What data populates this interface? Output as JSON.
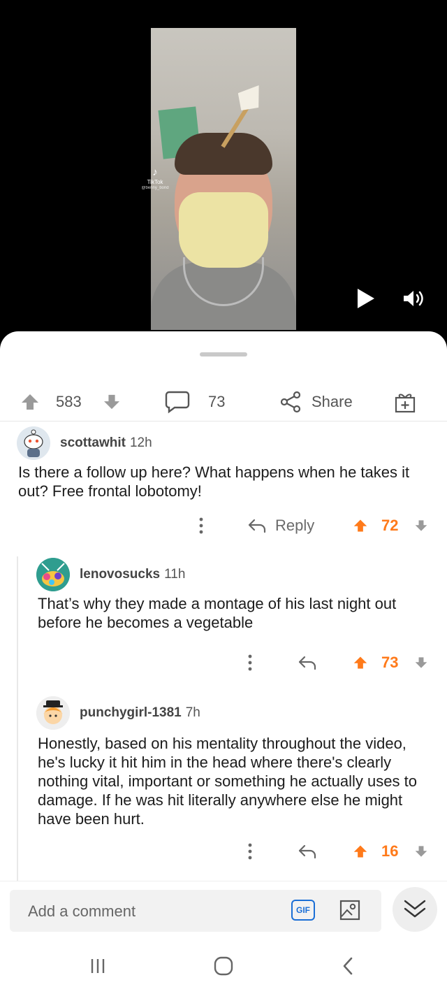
{
  "video": {
    "watermark_brand": "TikTok",
    "watermark_handle": "@benny_bond",
    "play_icon": "play-icon",
    "sound_icon": "volume-icon"
  },
  "post_actions": {
    "upvote_icon": "upvote-arrow-icon",
    "score": "583",
    "downvote_icon": "downvote-arrow-icon",
    "comment_icon": "comment-bubble-icon",
    "comment_count": "73",
    "share_icon": "share-icon",
    "share_label": "Share",
    "award_icon": "gift-award-icon"
  },
  "comments": [
    {
      "author": "scottawhit",
      "age": "12h",
      "body": "Is there a follow up here? What happens when he takes it out? Free frontal lobotomy!",
      "more_icon": "more-vertical-icon",
      "reply_label": "Reply",
      "score": "72"
    },
    {
      "author": "lenovosucks",
      "age": "11h",
      "body": "That’s why they made a montage of his last night out before he becomes a vegetable",
      "more_icon": "more-vertical-icon",
      "score": "73"
    },
    {
      "author": "punchygirl-1381",
      "age": "7h",
      "body": "Honestly, based on his mentality throughout the video, he's lucky it hit him in the head where there's clearly nothing vital, important or something he actually uses to damage.  If he was hit literally anywhere else he might have been hurt.",
      "more_icon": "more-vertical-icon",
      "score": "16"
    }
  ],
  "comment_bar": {
    "placeholder": "Add a comment",
    "gif_label": "GIF",
    "image_icon": "image-icon",
    "collapse_icon": "double-chevron-down-icon"
  },
  "navbar": {
    "recents_icon": "recents-icon",
    "home_icon": "home-icon",
    "back_icon": "back-icon"
  },
  "colors": {
    "upvote_orange": "#ff7a1a",
    "gif_blue": "#1b6fd6",
    "text_dark": "#1c1c1c",
    "meta_gray": "#555555"
  }
}
